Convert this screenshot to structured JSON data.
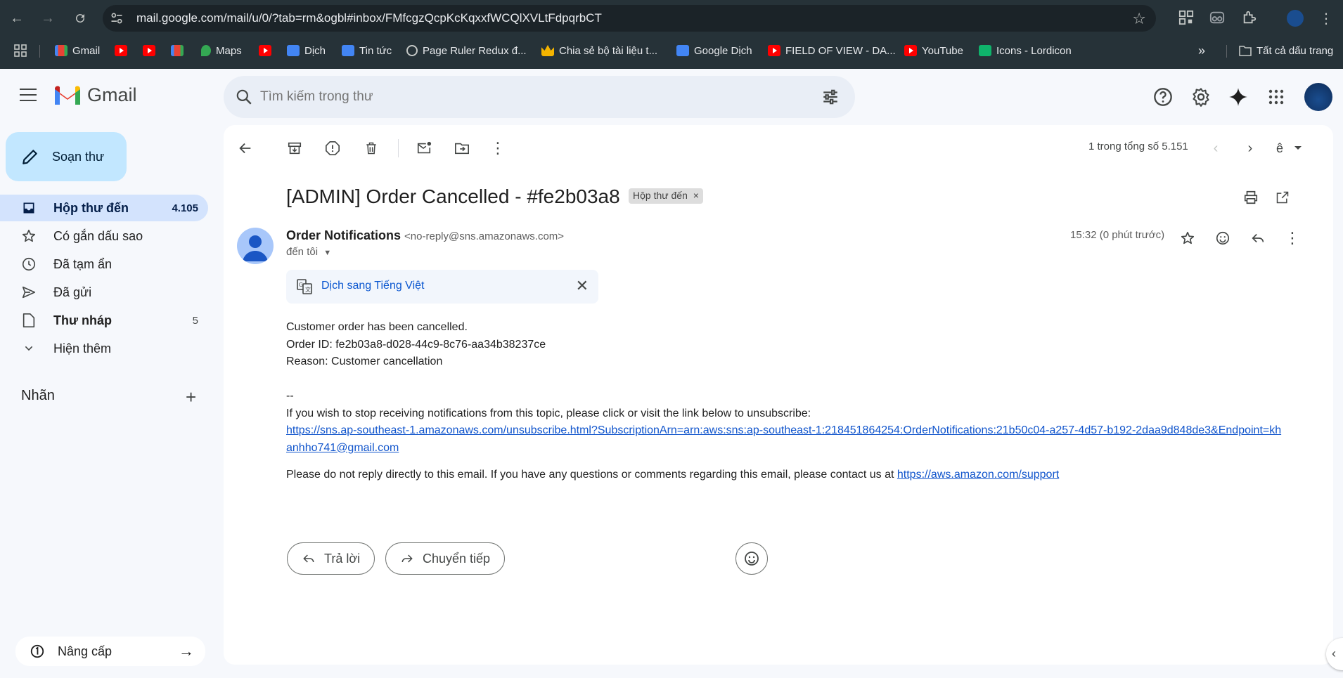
{
  "browser": {
    "url": "mail.google.com/mail/u/0/?tab=rm&ogbl#inbox/FMfcgzQcpKcKqxxfWCQlXVLtFdpqrbCT",
    "bookmarks": [
      {
        "label": "Gmail",
        "icon": "gmail-icon"
      },
      {
        "label": "",
        "icon": "youtube-icon"
      },
      {
        "label": "",
        "icon": "youtube-icon"
      },
      {
        "label": "",
        "icon": "gmail-icon"
      },
      {
        "label": "Maps",
        "icon": "maps-icon"
      },
      {
        "label": "",
        "icon": "youtube-icon"
      },
      {
        "label": "Dịch",
        "icon": "translate-icon"
      },
      {
        "label": "Tin tức",
        "icon": "news-icon"
      },
      {
        "label": "Page Ruler Redux đ...",
        "icon": "globe-icon"
      },
      {
        "label": "Chia sẻ bộ tài liệu t...",
        "icon": "crown-icon"
      },
      {
        "label": "Google Dịch",
        "icon": "translate-icon"
      },
      {
        "label": "FIELD OF VIEW - DA...",
        "icon": "youtube-icon"
      },
      {
        "label": "YouTube",
        "icon": "youtube-icon"
      },
      {
        "label": "Icons - Lordicon",
        "icon": "lordicon-icon"
      }
    ],
    "all_bookmarks": "Tất cả dấu trang",
    "more_bookmarks": "»"
  },
  "gmail": {
    "brand": "Gmail",
    "search_placeholder": "Tìm kiếm trong thư",
    "colors": {
      "accent": "#0b57d0",
      "compose_bg": "#c2e7ff",
      "active_nav": "#d3e3fd",
      "link": "#1155cc"
    }
  },
  "sidebar": {
    "compose": "Soạn thư",
    "items": [
      {
        "label": "Hộp thư đến",
        "count": "4.105",
        "icon": "inbox-icon"
      },
      {
        "label": "Có gắn dấu sao",
        "count": "",
        "icon": "star-icon"
      },
      {
        "label": "Đã tạm ẩn",
        "count": "",
        "icon": "clock-icon"
      },
      {
        "label": "Đã gửi",
        "count": "",
        "icon": "send-icon"
      },
      {
        "label": "Thư nháp",
        "count": "5",
        "icon": "draft-icon"
      },
      {
        "label": "Hiện thêm",
        "count": "",
        "icon": "chevron-down-icon"
      }
    ],
    "labels_heading": "Nhãn",
    "upgrade": "Nâng cấp"
  },
  "message": {
    "pager": "1 trong tổng số 5.151",
    "subject": "[ADMIN] Order Cancelled - #fe2b03a8",
    "chip": "Hộp thư đến",
    "sender_name": "Order Notifications",
    "sender_email": "<no-reply@sns.amazonaws.com>",
    "to": "đến tôi",
    "time": "15:32 (0 phút trước)",
    "translate": "Dịch sang Tiếng Việt",
    "body": {
      "line1": "Customer order has been cancelled.",
      "line2": "Order ID: fe2b03a8-d028-44c9-8c76-aa34b38237ce",
      "line3": "Reason: Customer cancellation",
      "sig": "--",
      "unsub_text": "If you wish to stop receiving notifications from this topic, please click or visit the link below to unsubscribe:",
      "unsub_link": "https://sns.ap-southeast-1.amazonaws.com/unsubscribe.html?SubscriptionArn=arn:aws:sns:ap-southeast-1:218451864254:OrderNotifications:21b50c04-a257-4d57-b192-2daa9d848de3&Endpoint=khanhho741@gmail.com",
      "noreply_text": "Please do not reply directly to this email. If you have any questions or comments regarding this email, please contact us at ",
      "support_link": "https://aws.amazon.com/support"
    },
    "reply_btn": "Trả lời",
    "forward_btn": "Chuyển tiếp"
  }
}
